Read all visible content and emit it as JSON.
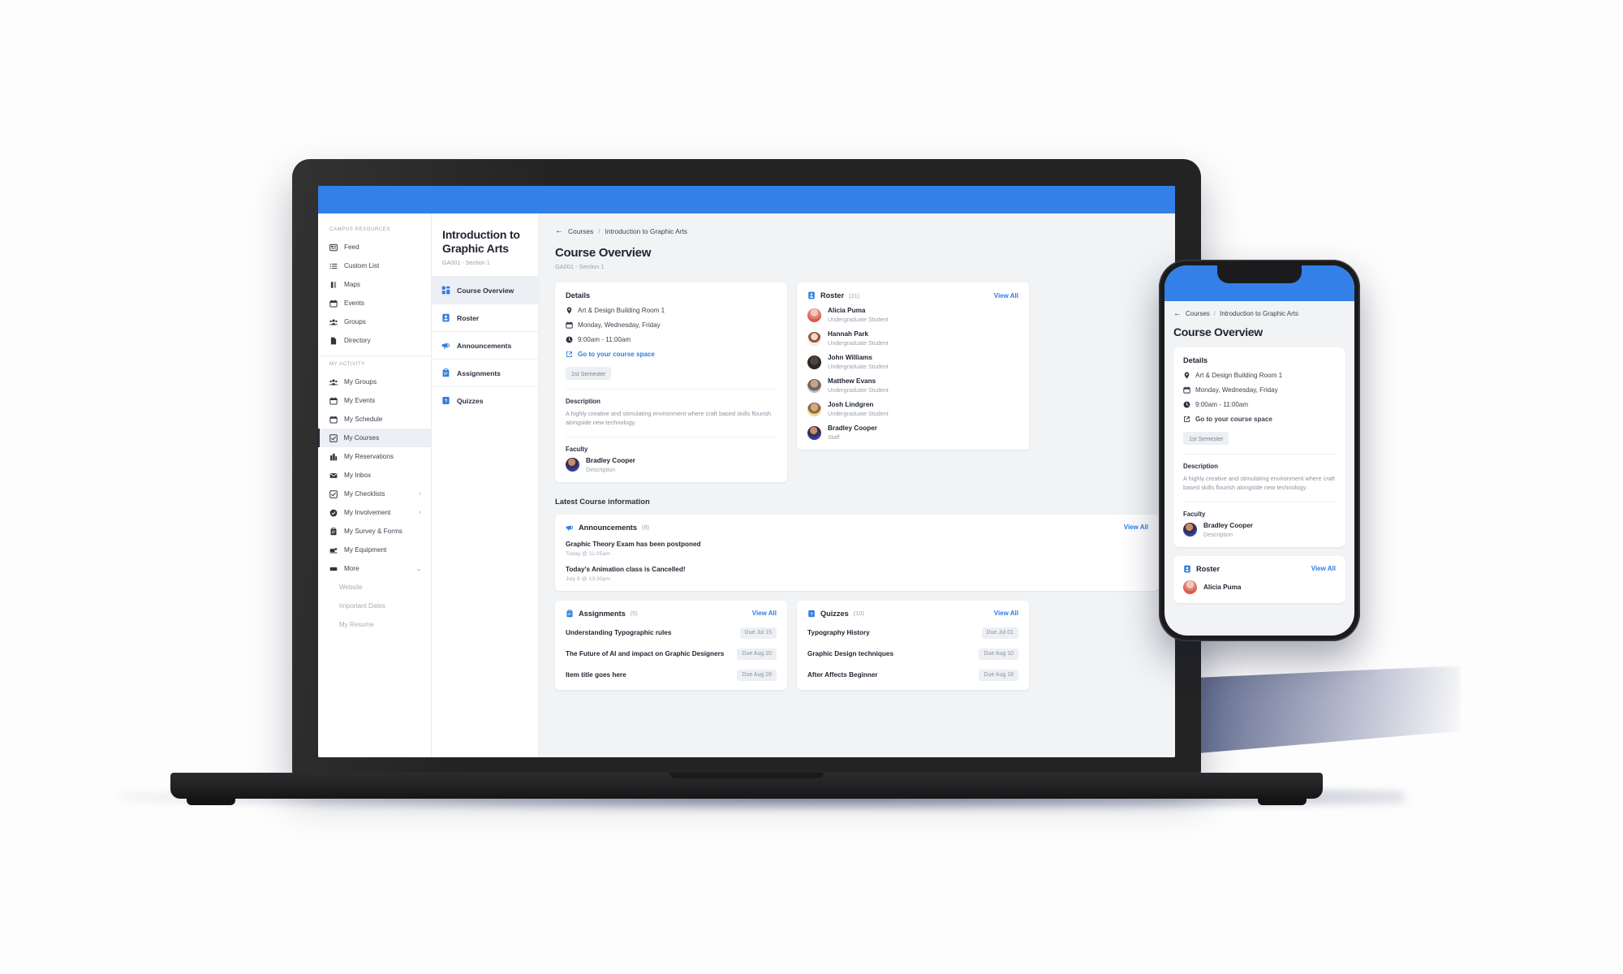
{
  "brand": {
    "accent": "#3380e8",
    "link": "#2f7de1",
    "bg": "#f1f3f5"
  },
  "sidebar": {
    "groups": [
      {
        "label": "CAMPUS RESOURCES",
        "items": [
          {
            "label": "Feed",
            "icon": "feed-icon"
          },
          {
            "label": "Custom List",
            "icon": "list-icon"
          },
          {
            "label": "Maps",
            "icon": "map-icon"
          },
          {
            "label": "Events",
            "icon": "calendar-icon"
          },
          {
            "label": "Groups",
            "icon": "groups-icon"
          },
          {
            "label": "Directory",
            "icon": "document-icon"
          }
        ]
      },
      {
        "label": "MY ACTIVITY",
        "items": [
          {
            "label": "My Groups",
            "icon": "groups-icon"
          },
          {
            "label": "My Events",
            "icon": "calendar-icon"
          },
          {
            "label": "My Schedule",
            "icon": "calendar-icon"
          },
          {
            "label": "My Courses",
            "icon": "checkbox-icon",
            "active": true
          },
          {
            "label": "My Reservations",
            "icon": "building-icon"
          },
          {
            "label": "My Inbox",
            "icon": "envelope-icon"
          },
          {
            "label": "My Checklists",
            "icon": "checkbox-icon",
            "chevron": "›"
          },
          {
            "label": "My Involvement",
            "icon": "badge-icon",
            "chevron": "›"
          },
          {
            "label": "My Survey & Forms",
            "icon": "clipboard-icon"
          },
          {
            "label": "My Equipment",
            "icon": "equipment-icon"
          },
          {
            "label": "More",
            "icon": "more-icon",
            "chevron": "⌄"
          }
        ],
        "sub_items": [
          {
            "label": "Website"
          },
          {
            "label": "Important Dates"
          },
          {
            "label": "My Resume"
          }
        ]
      }
    ]
  },
  "course_nav": {
    "title": "Introduction to Graphic Arts",
    "subtitle": "GA001 - Section 1",
    "items": [
      {
        "label": "Course Overview",
        "icon": "grid-icon",
        "active": true
      },
      {
        "label": "Roster",
        "icon": "roster-icon"
      },
      {
        "label": "Announcements",
        "icon": "megaphone-icon"
      },
      {
        "label": "Assignments",
        "icon": "clipboard-icon"
      },
      {
        "label": "Quizzes",
        "icon": "quiz-icon"
      }
    ]
  },
  "breadcrumb": {
    "back": "←",
    "parent": "Courses",
    "separator": "/",
    "current": "Introduction to Graphic Arts"
  },
  "page": {
    "title": "Course Overview",
    "subtitle": "GA001 - Section 1"
  },
  "details": {
    "heading": "Details",
    "location": "Art & Design Building Room 1",
    "days": "Monday, Wednesday, Friday",
    "time": "9:00am - 11:00am",
    "link": "Go to your course space",
    "chip": "1st Semester",
    "description_heading": "Description",
    "description": "A highly creative and stimulating environment where craft based skills flourish alongside new technology.",
    "faculty_heading": "Faculty",
    "faculty": {
      "name": "Bradley Cooper",
      "role": "Description"
    }
  },
  "roster": {
    "heading": "Roster",
    "count": "(21)",
    "view_all": "View All",
    "people": [
      {
        "name": "Alicia Puma",
        "role": "Undergraduate Student",
        "avatar": "av1"
      },
      {
        "name": "Hannah Park",
        "role": "Undergraduate Student",
        "avatar": "av2"
      },
      {
        "name": "John Williams",
        "role": "Undergraduate Student",
        "avatar": "av3"
      },
      {
        "name": "Matthew Evans",
        "role": "Undergraduate Student",
        "avatar": "av4"
      },
      {
        "name": "Josh Lindgren",
        "role": "Undergraduate Student",
        "avatar": "av5"
      },
      {
        "name": "Bradley Cooper",
        "role": "Staff",
        "avatar": "av6"
      }
    ]
  },
  "latest": {
    "title": "Latest Course information"
  },
  "announcements": {
    "heading": "Announcements",
    "count": "(8)",
    "view_all": "View All",
    "items": [
      {
        "title": "Graphic Theory Exam has been postponed",
        "meta": "Today @ 11:05am"
      },
      {
        "title": "Today’s Animation class is Cancelled!",
        "meta": "July 8 @ 13:30pm"
      }
    ]
  },
  "assignments": {
    "heading": "Assignments",
    "count": "(5)",
    "view_all": "View All",
    "items": [
      {
        "title": "Understanding Typographic rules",
        "due": "Due Jul 15"
      },
      {
        "title": "The Future of AI and impact on Graphic Designers",
        "due": "Due Aug 20"
      },
      {
        "title": "Item title goes here",
        "due": "Due Aug 28"
      }
    ]
  },
  "quizzes": {
    "heading": "Quizzes",
    "count": "(10)",
    "view_all": "View All",
    "items": [
      {
        "title": "Typography History",
        "due": "Due Jul 01"
      },
      {
        "title": "Graphic Design techniques",
        "due": "Due Aug 10"
      },
      {
        "title": "After Affects Beginner",
        "due": "Due Aug 18"
      }
    ]
  },
  "phone": {
    "breadcrumb": {
      "back": "←",
      "parent": "Courses",
      "separator": "/",
      "current": "Introduction to Graphic Arts"
    },
    "title": "Course Overview",
    "details_heading": "Details",
    "location": "Art & Design Building Room 1",
    "days": "Monday, Wednesday, Friday",
    "time": "9:00am - 11:00am",
    "link": "Go to your course space",
    "chip": "1st Semester",
    "description_heading": "Description",
    "description": "A highly creative and stimulating environment where craft based skills flourish alongside new technology.",
    "faculty_heading": "Faculty",
    "faculty": {
      "name": "Bradley Cooper",
      "role": "Description"
    },
    "roster_heading": "Roster",
    "roster_view_all": "View All",
    "roster_first": "Alicia Puma"
  }
}
